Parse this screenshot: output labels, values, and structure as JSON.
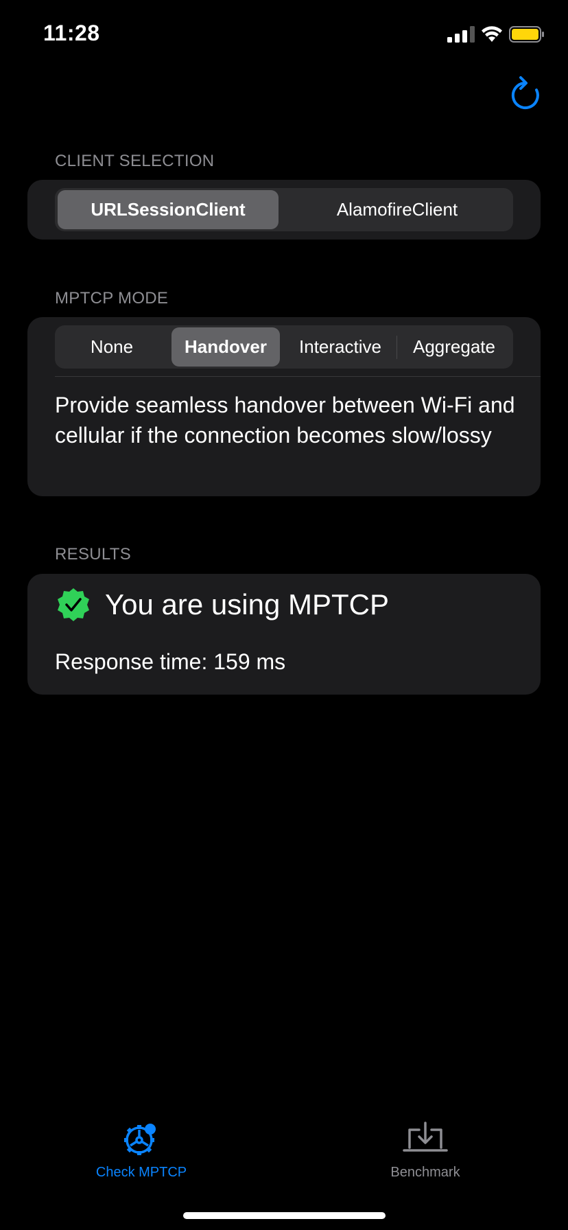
{
  "status_bar": {
    "time": "11:28"
  },
  "client_selection": {
    "header": "CLIENT SELECTION",
    "options": [
      "URLSessionClient",
      "AlamofireClient"
    ],
    "selected": "URLSessionClient"
  },
  "mptcp_mode": {
    "header": "MPTCP MODE",
    "options": [
      "None",
      "Handover",
      "Interactive",
      "Aggregate"
    ],
    "selected": "Handover",
    "description": "Provide seamless handover between Wi-Fi and cellular if the connection becomes slow/lossy"
  },
  "results": {
    "header": "RESULTS",
    "title": "You are using MPTCP",
    "response_time": "Response time: 159 ms",
    "status_color": "#30d158"
  },
  "tab_bar": {
    "tabs": [
      {
        "label": "Check MPTCP",
        "icon": "gear-badge-icon",
        "active": true
      },
      {
        "label": "Benchmark",
        "icon": "laptop-download-icon",
        "active": false
      }
    ]
  },
  "colors": {
    "accent": "#0a84ff",
    "inactive": "#8e8e93",
    "background": "#000000",
    "card": "#1c1c1e"
  }
}
